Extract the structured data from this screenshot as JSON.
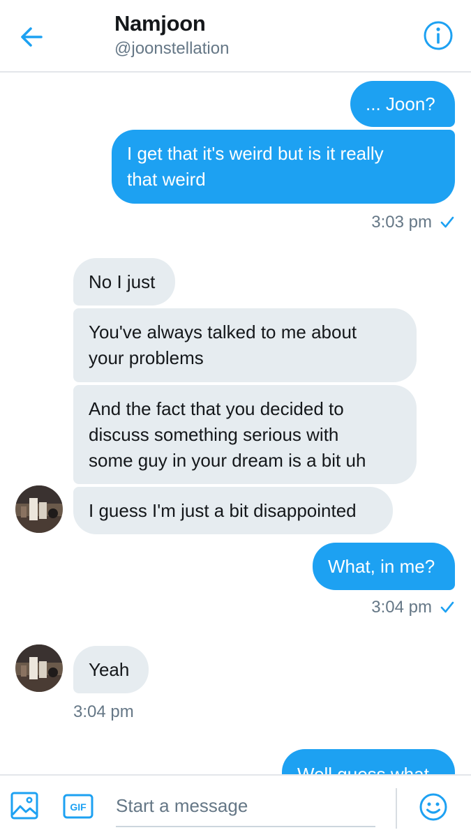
{
  "header": {
    "title": "Namjoon",
    "handle": "@joonstellation",
    "back_icon": "arrow-left-icon",
    "info_icon": "info-icon",
    "accent_color": "#1da1f2"
  },
  "messages": {
    "m1": "... Joon?",
    "m2": "I get that it's weird but is it really\nthat weird",
    "t1": "3:03 pm",
    "m3": "No I just",
    "m4": "You've always talked to me about\nyour problems",
    "m5": "And the fact that you decided to\ndiscuss something serious with\nsome guy in your dream is a bit uh",
    "m6": "I guess I'm just a bit disappointed",
    "m7": "What, in me?",
    "t2": "3:04 pm",
    "m8": "Yeah",
    "t3": "3:04 pm",
    "m9": "Well guess what"
  },
  "composer": {
    "placeholder": "Start a message",
    "media_icon": "image-icon",
    "gif_label": "GIF",
    "emoji_icon": "smiley-icon"
  },
  "colors": {
    "outgoing_bubble": "#1da1f2",
    "incoming_bubble": "#e6ecf0",
    "secondary_text": "#657786"
  }
}
